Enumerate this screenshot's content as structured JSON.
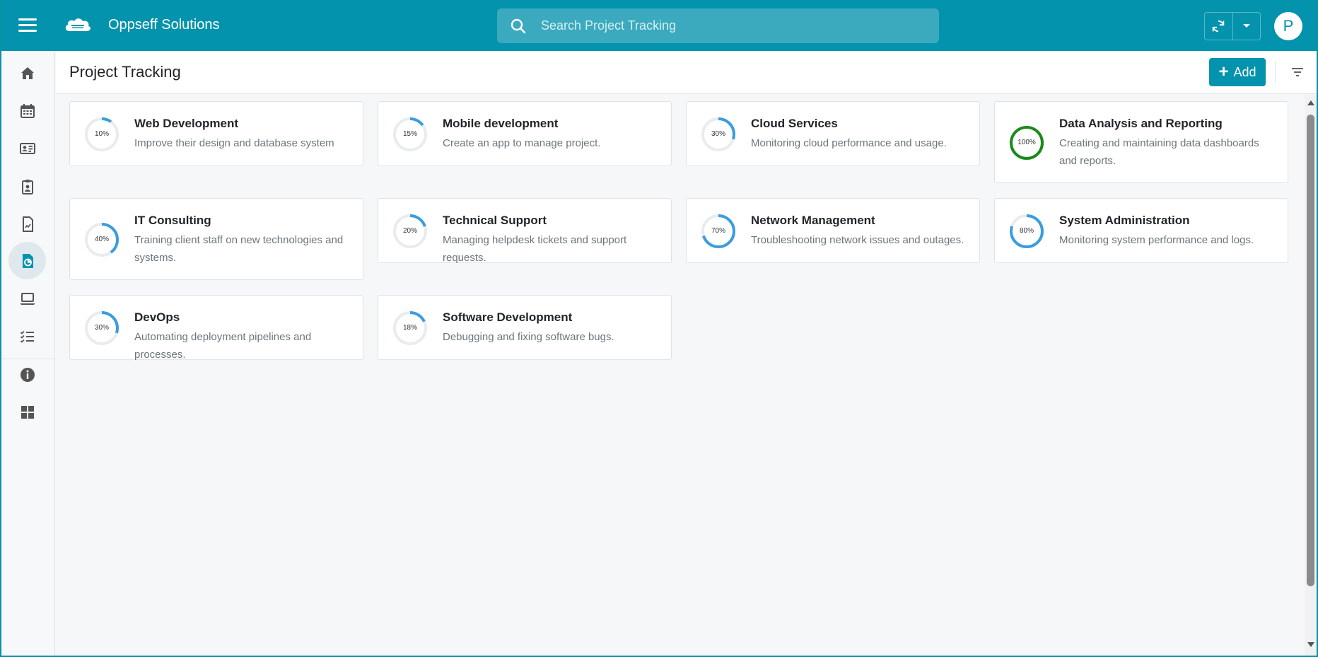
{
  "app": {
    "name": "Oppseff Solutions",
    "avatar_initial": "P"
  },
  "search": {
    "placeholder": "Search Project Tracking"
  },
  "page": {
    "title": "Project Tracking",
    "add_label": "Add"
  },
  "sidebar": {
    "items": [
      {
        "name": "home-icon",
        "active": false
      },
      {
        "name": "calendar-icon",
        "active": false
      },
      {
        "name": "contact-card-icon",
        "active": false
      },
      {
        "name": "clipboard-user-icon",
        "active": false
      },
      {
        "name": "report-chart-icon",
        "active": false
      },
      {
        "name": "project-report-icon",
        "active": true
      },
      {
        "name": "laptop-icon",
        "active": false
      },
      {
        "name": "task-list-icon",
        "active": false
      },
      {
        "name": "info-icon",
        "active": false
      },
      {
        "name": "dashboard-grid-icon",
        "active": false
      }
    ]
  },
  "colors": {
    "accent": "#0493ad",
    "progress": "#3b9ddd",
    "complete": "#1a8a1a",
    "track": "#e9ecef"
  },
  "projects": [
    {
      "title": "Web Development",
      "description": "Improve their design and database system",
      "progress": 10,
      "progress_label": "10%"
    },
    {
      "title": "Mobile development",
      "description": "Create an app to manage project.",
      "progress": 15,
      "progress_label": "15%"
    },
    {
      "title": "Cloud Services",
      "description": "Monitoring cloud performance and usage.",
      "progress": 30,
      "progress_label": "30%"
    },
    {
      "title": "Data Analysis and Reporting",
      "description": "Creating and maintaining data dashboards and reports.",
      "progress": 100,
      "progress_label": "100%"
    },
    {
      "title": "IT Consulting",
      "description": "Training client staff on new technologies and systems.",
      "progress": 40,
      "progress_label": "40%"
    },
    {
      "title": "Technical Support",
      "description": "Managing helpdesk tickets and support requests.",
      "progress": 20,
      "progress_label": "20%"
    },
    {
      "title": "Network Management",
      "description": "Troubleshooting network issues and outages.",
      "progress": 70,
      "progress_label": "70%"
    },
    {
      "title": "System Administration",
      "description": "Monitoring system performance and logs.",
      "progress": 80,
      "progress_label": "80%"
    },
    {
      "title": "DevOps",
      "description": "Automating deployment pipelines and processes.",
      "progress": 30,
      "progress_label": "30%"
    },
    {
      "title": "Software Development",
      "description": "Debugging and fixing software bugs.",
      "progress": 18,
      "progress_label": "18%"
    }
  ]
}
